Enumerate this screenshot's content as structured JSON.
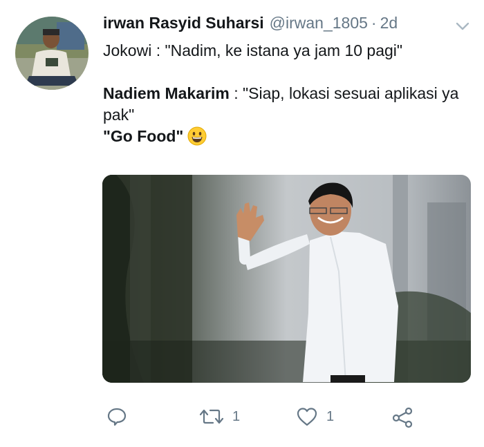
{
  "tweet": {
    "display_name": "irwan Rasyid Suharsi",
    "handle": "@irwan_1805",
    "separator": "·",
    "time": "2d",
    "line1": "Jokowi : \"Nadim, ke istana ya jam 10 pagi\"",
    "line2_speaker": "Nadiem Makarim",
    "line2_rest": " : \"Siap, lokasi sesuai aplikasi ya pak\"",
    "line3": "\"Go Food\"",
    "emoji": "grinning-face-emoji"
  },
  "actions": {
    "reply": {
      "icon": "reply-icon",
      "count": ""
    },
    "retweet": {
      "icon": "retweet-icon",
      "count": "1"
    },
    "like": {
      "icon": "heart-icon",
      "count": "1"
    },
    "share": {
      "icon": "share-icon",
      "count": ""
    }
  },
  "colors": {
    "text": "#14171a",
    "muted": "#657786",
    "background": "#ffffff"
  }
}
